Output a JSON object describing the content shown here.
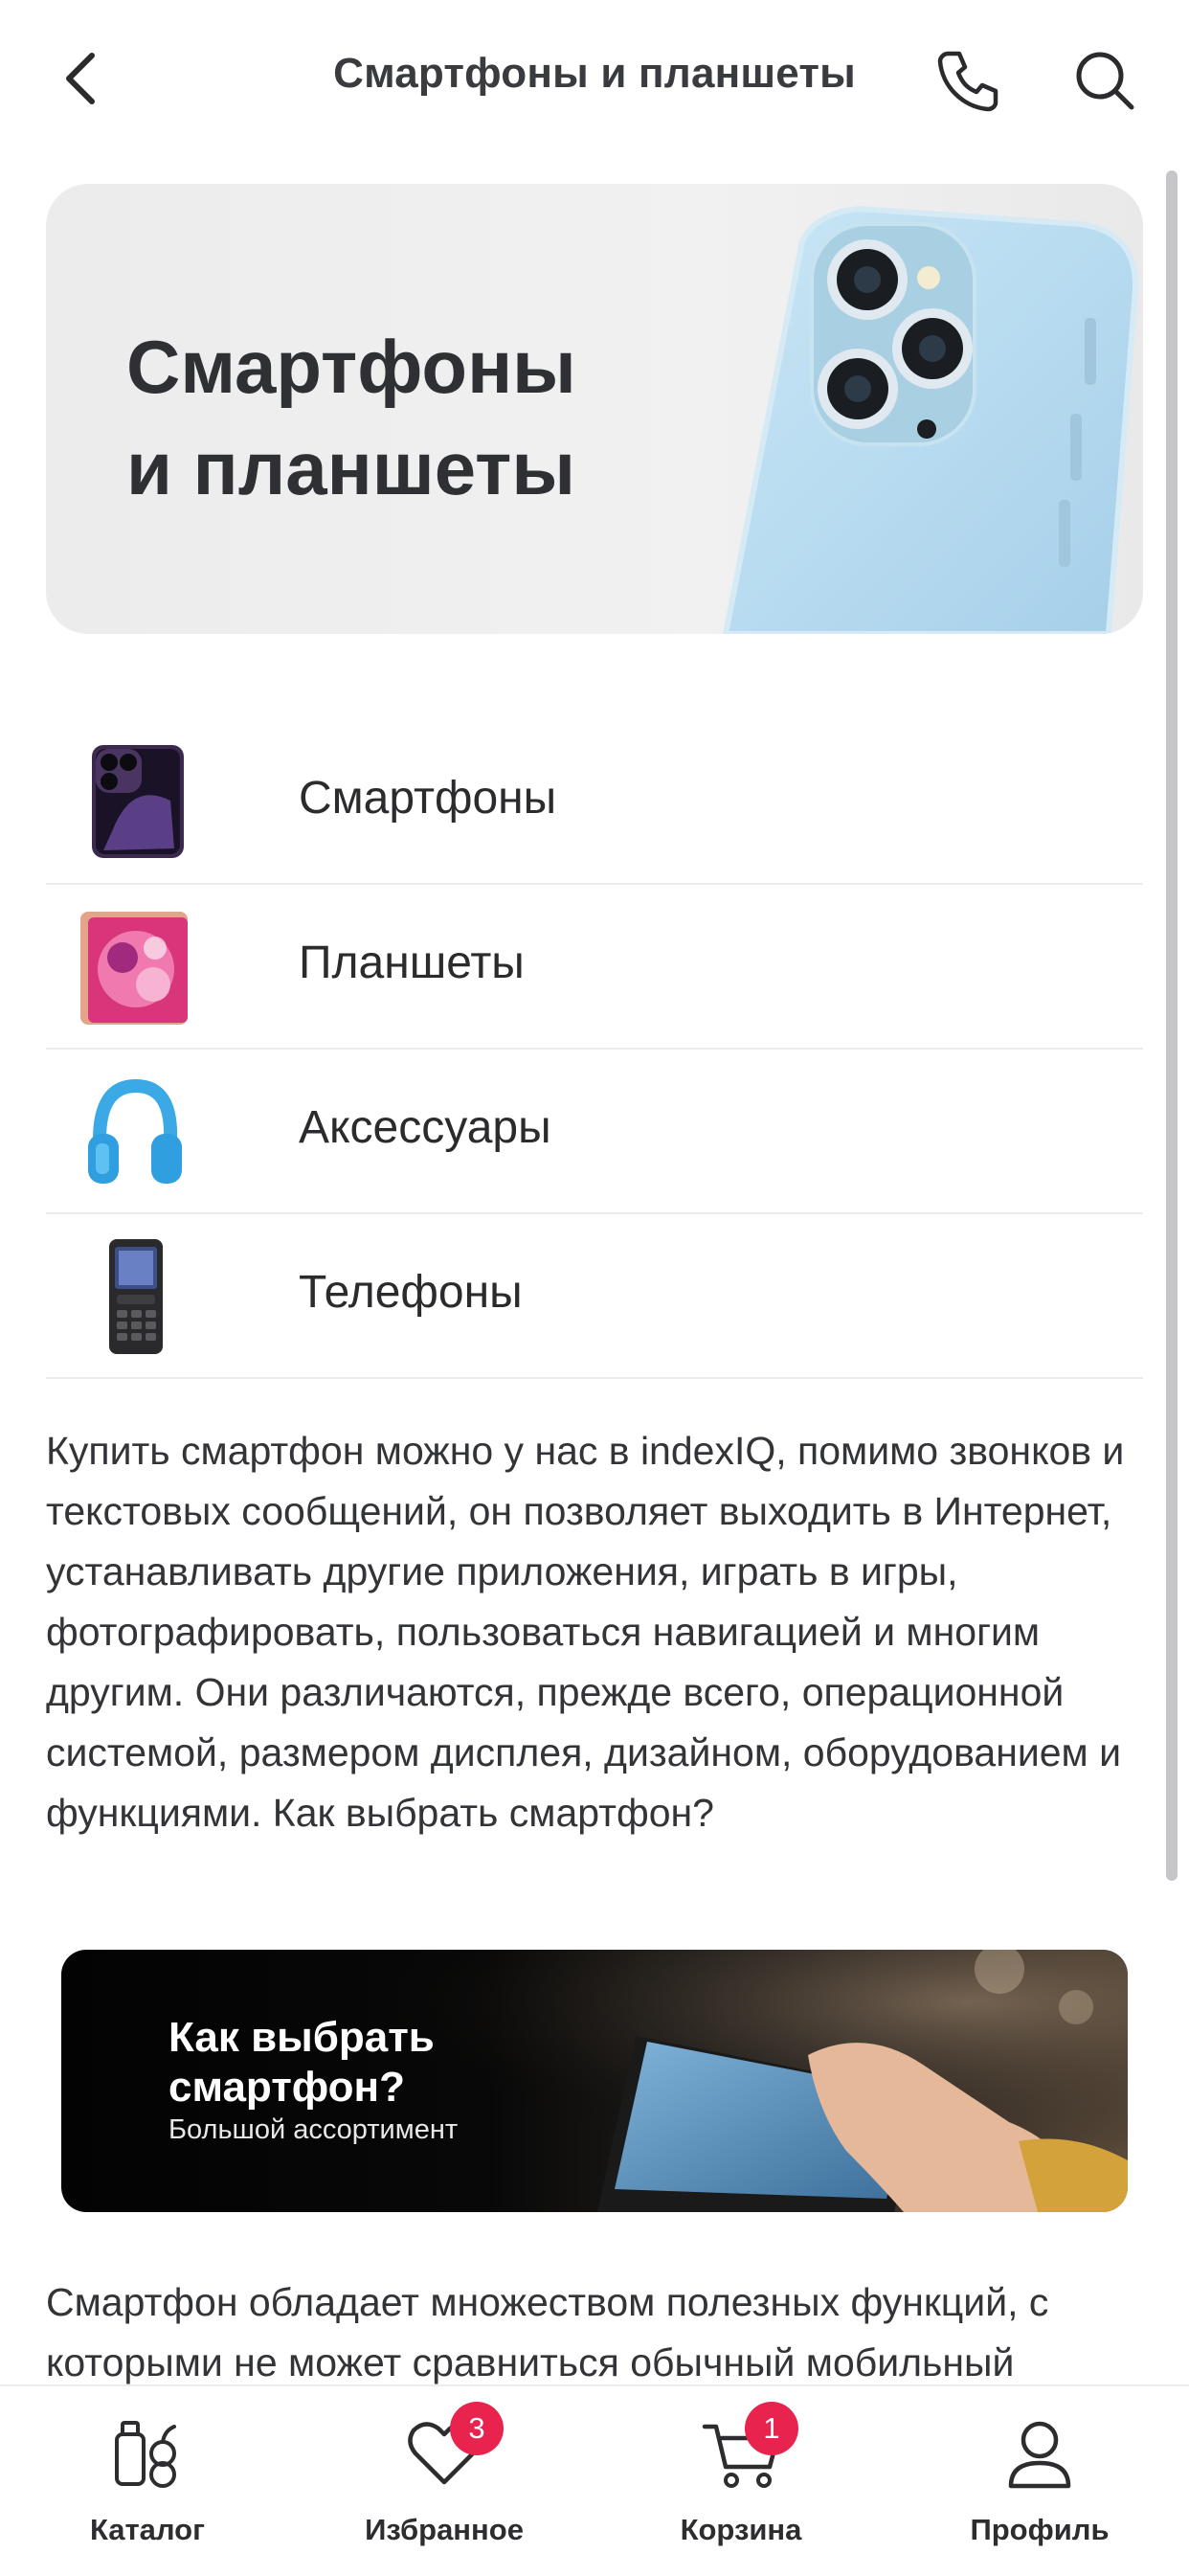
{
  "colors": {
    "accent_badge": "#e8244e",
    "text_primary": "#2b2b2e",
    "divider": "#ececec",
    "hero_bg": "#efefef",
    "promo_bg": "#050505"
  },
  "header": {
    "title": "Смартфоны и планшеты",
    "back_icon": "chevron-left-icon",
    "phone_icon": "phone-icon",
    "search_icon": "search-icon"
  },
  "hero": {
    "title": "Смартфоны\nи планшеты"
  },
  "categories": [
    {
      "label": "Смартфоны",
      "icon": "smartphone-thumbnail"
    },
    {
      "label": "Планшеты",
      "icon": "tablet-thumbnail"
    },
    {
      "label": "Аксессуары",
      "icon": "headphones-thumbnail"
    },
    {
      "label": "Телефоны",
      "icon": "feature-phone-thumbnail"
    }
  ],
  "article": {
    "paragraph1": "Купить смартфон можно у нас в indexIQ, помимо звонков и текстовых сообщений, он позволяет выходить в Интернет, устанавливать другие приложения, играть в игры, фотографировать, пользоваться навигацией и многим другим. Они различаются, прежде всего, операционной системой, размером дисплея, дизайном, оборудованием и функциями. Как выбрать смартфон?",
    "paragraph2": "Смартфон обладает множеством полезных функций, с которыми не может сравниться обычный мобильный"
  },
  "promo": {
    "title": "Как выбрать\nсмартфон?",
    "subtitle": "Большой ассортимент"
  },
  "tabbar": {
    "items": [
      {
        "label": "Каталог",
        "icon": "catalog-icon",
        "badge": ""
      },
      {
        "label": "Избранное",
        "icon": "heart-icon",
        "badge": "3"
      },
      {
        "label": "Корзина",
        "icon": "cart-icon",
        "badge": "1"
      },
      {
        "label": "Профиль",
        "icon": "profile-icon",
        "badge": ""
      }
    ]
  }
}
